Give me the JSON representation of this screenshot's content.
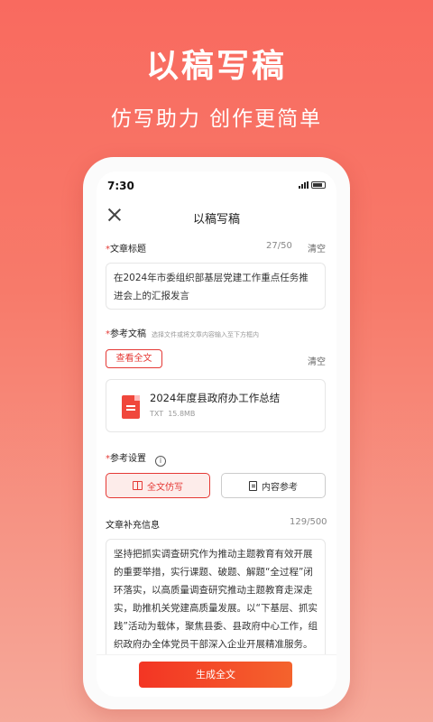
{
  "hero": {
    "title": "以稿写稿",
    "subtitle": "仿写助力 创作更简单"
  },
  "status_bar": {
    "time": "7:30"
  },
  "nav": {
    "title": "以稿写稿"
  },
  "article_title": {
    "required_mark": "*",
    "label": "文章标题",
    "counter": "27/50",
    "clear_label": "清空",
    "value": "在2024年市委组织部基层党建工作重点任务推进会上的汇报发言"
  },
  "reference_doc": {
    "required_mark": "*",
    "label": "参考文稿",
    "hint": "选择文件或将文章内容输入至下方框内",
    "view_full_label": "查看全文",
    "clear_label": "清空",
    "file": {
      "name": "2024年度县政府办工作总结",
      "type": "TXT",
      "size": "15.8MB"
    }
  },
  "reference_settings": {
    "required_mark": "*",
    "label": "参考设置",
    "info_glyph": "i",
    "options": [
      {
        "label": "全文仿写",
        "selected": true
      },
      {
        "label": "内容参考",
        "selected": false
      }
    ]
  },
  "supplement": {
    "label": "文章补充信息",
    "counter": "129/500",
    "value": "坚持把抓实调查研究作为推动主题教育有效开展的重要举措，实行课题、破题、解题“全过程”闭环落实，以高质量调查研究推动主题教育走深走实，助推机关党建高质量发展。以“下基层、抓实践”活动为载体，聚焦县委、县政府中心工作，组织政府办全体党员干部深入企业开展精准服务。"
  },
  "footer": {
    "generate_label": "生成全文"
  },
  "colors": {
    "accent": "#e53935",
    "hero_bg": "#f96a5f",
    "primary_btn": "#f33524"
  }
}
